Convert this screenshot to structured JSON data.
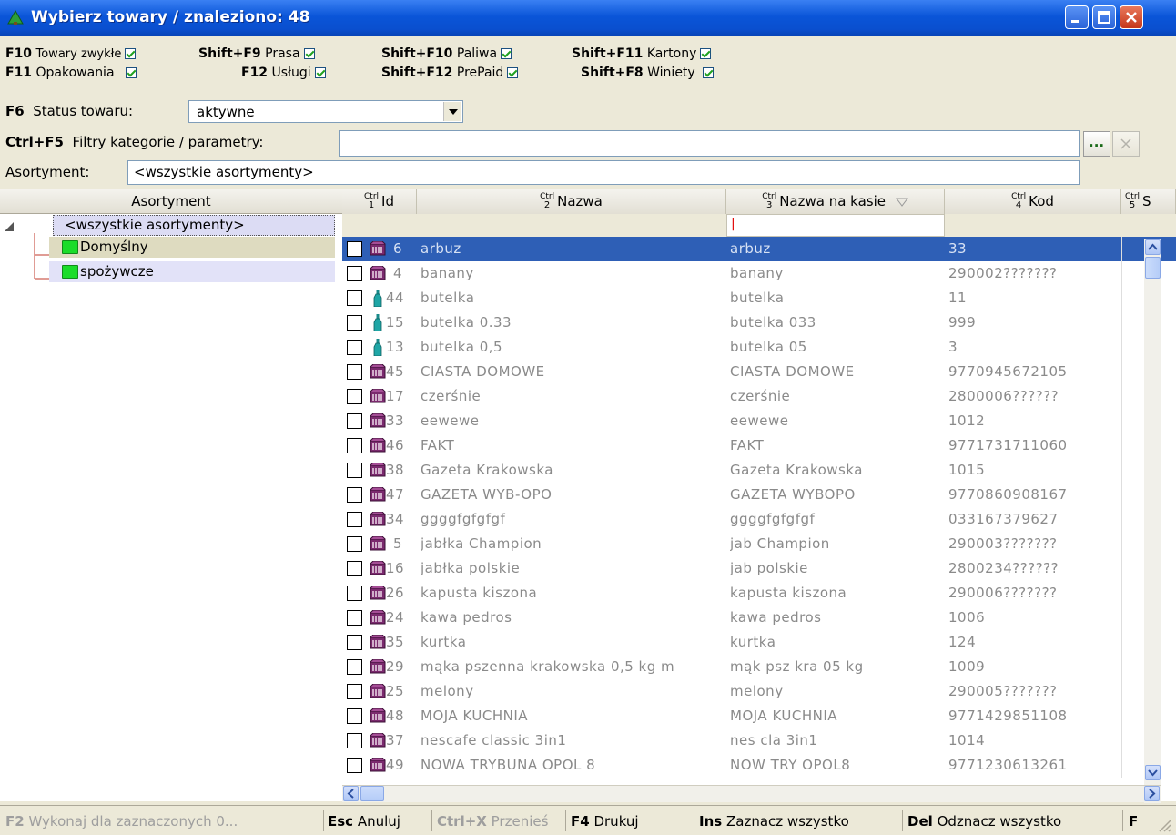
{
  "window": {
    "title": "Wybierz towary / znaleziono: 48"
  },
  "filters": [
    {
      "key": "F10",
      "label": "Towary zwykłe",
      "checked": true
    },
    {
      "key": "Shift+F9",
      "label": "Prasa",
      "checked": true
    },
    {
      "key": "Shift+F10",
      "label": "Paliwa",
      "checked": true
    },
    {
      "key": "Shift+F11",
      "label": "Kartony",
      "checked": true
    },
    {
      "key": "F11",
      "label": "Opakowania",
      "checked": true
    },
    {
      "key": "F12",
      "label": "Usługi",
      "checked": true
    },
    {
      "key": "Shift+F12",
      "label": "PrePaid",
      "checked": true
    },
    {
      "key": "Shift+F8",
      "label": "Winiety",
      "checked": true
    }
  ],
  "status": {
    "key": "F6",
    "label": "Status towaru:",
    "value": "aktywne"
  },
  "category_filter": {
    "key": "Ctrl+F5",
    "label": "Filtry kategorie / parametry:",
    "value": "",
    "browse_label": "..."
  },
  "assortment": {
    "label": "Asortyment:",
    "value": "<wszystkie asortymenty>"
  },
  "tree": {
    "header": "Asortyment",
    "nodes": [
      {
        "label": "<wszystkie asortymenty>"
      },
      {
        "label": "Domyślny"
      },
      {
        "label": "spożywcze"
      }
    ]
  },
  "grid": {
    "ctrl_label": "Ctrl",
    "columns": [
      {
        "num": "1",
        "label": "Id"
      },
      {
        "num": "2",
        "label": "Nazwa"
      },
      {
        "num": "3",
        "label": "Nazwa na kasie"
      },
      {
        "num": "4",
        "label": "Kod"
      },
      {
        "num": "5",
        "label": "S"
      }
    ],
    "filter_value": "|",
    "rows": [
      {
        "id": "6",
        "name": "arbuz",
        "till": "arbuz",
        "code": "33",
        "icon": "box",
        "selected": true
      },
      {
        "id": "4",
        "name": "banany",
        "till": "banany",
        "code": "290002???????",
        "icon": "box"
      },
      {
        "id": "44",
        "name": "butelka",
        "till": "butelka",
        "code": "11",
        "icon": "bottle"
      },
      {
        "id": "15",
        "name": "butelka 0.33",
        "till": "butelka 033",
        "code": "999",
        "icon": "bottle"
      },
      {
        "id": "13",
        "name": "butelka 0,5",
        "till": "butelka 05",
        "code": "3",
        "icon": "bottle"
      },
      {
        "id": "45",
        "name": "CIASTA DOMOWE",
        "till": "CIASTA DOMOWE",
        "code": "9770945672105",
        "icon": "box"
      },
      {
        "id": "17",
        "name": "czerśnie",
        "till": "czerśnie",
        "code": "2800006??????",
        "icon": "box"
      },
      {
        "id": "33",
        "name": "eewewe",
        "till": "eewewe",
        "code": "1012",
        "icon": "box"
      },
      {
        "id": "46",
        "name": "FAKT",
        "till": "FAKT",
        "code": "9771731711060",
        "icon": "box"
      },
      {
        "id": "38",
        "name": "Gazeta Krakowska",
        "till": "Gazeta Krakowska",
        "code": "1015",
        "icon": "box"
      },
      {
        "id": "47",
        "name": "GAZETA WYB-OPO",
        "till": "GAZETA WYBOPO",
        "code": "9770860908167",
        "icon": "box"
      },
      {
        "id": "34",
        "name": "ggggfgfgfgf",
        "till": "ggggfgfgfgf",
        "code": "033167379627",
        "icon": "box"
      },
      {
        "id": "5",
        "name": "jabłka Champion",
        "till": "jab Champion",
        "code": "290003???????",
        "icon": "box"
      },
      {
        "id": "16",
        "name": "jabłka polskie",
        "till": "jab polskie",
        "code": "2800234??????",
        "icon": "box"
      },
      {
        "id": "26",
        "name": "kapusta kiszona",
        "till": "kapusta kiszona",
        "code": "290006???????",
        "icon": "box"
      },
      {
        "id": "24",
        "name": "kawa pedros",
        "till": "kawa pedros",
        "code": "1006",
        "icon": "box"
      },
      {
        "id": "35",
        "name": "kurtka",
        "till": "kurtka",
        "code": "124",
        "icon": "box"
      },
      {
        "id": "29",
        "name": "mąka pszenna krakowska 0,5 kg m",
        "till": "mąk psz kra 05 kg",
        "code": "1009",
        "icon": "box"
      },
      {
        "id": "25",
        "name": "melony",
        "till": "melony",
        "code": "290005???????",
        "icon": "box"
      },
      {
        "id": "48",
        "name": "MOJA KUCHNIA",
        "till": "MOJA KUCHNIA",
        "code": "9771429851108",
        "icon": "box"
      },
      {
        "id": "37",
        "name": "nescafe classic 3in1",
        "till": "nes cla 3in1",
        "code": "1014",
        "icon": "box"
      },
      {
        "id": "49",
        "name": "NOWA TRYBUNA OPOL 8",
        "till": "NOW TRY OPOL8",
        "code": "9771230613261",
        "icon": "box"
      }
    ]
  },
  "statusbar": [
    {
      "key": "F2",
      "label": "Wykonaj dla zaznaczonych 0...",
      "enabled": false
    },
    {
      "key": "Esc",
      "label": "Anuluj",
      "enabled": true
    },
    {
      "key": "Ctrl+X",
      "label": "Przenieś",
      "enabled": false
    },
    {
      "key": "F4",
      "label": "Drukuj",
      "enabled": true
    },
    {
      "key": "Ins",
      "label": "Zaznacz wszystko",
      "enabled": true
    },
    {
      "key": "Del",
      "label": "Odznacz wszystko",
      "enabled": true
    },
    {
      "key": "F",
      "label": "",
      "enabled": true
    }
  ],
  "colors": {
    "title_bar": "#0a55d8",
    "selection": "#2e5fb6",
    "tree_root_bg": "#dcdcf4",
    "tree_default_bg": "#dedbc0",
    "tree_food_bg": "#e2e2f8",
    "folder": "#1adc2a",
    "checkmark": "#21a121"
  }
}
